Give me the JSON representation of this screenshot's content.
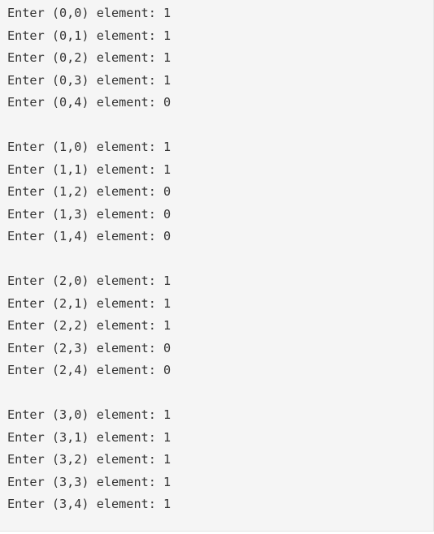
{
  "console": {
    "lines": [
      "Enter (0,0) element: 1",
      "Enter (0,1) element: 1",
      "Enter (0,2) element: 1",
      "Enter (0,3) element: 1",
      "Enter (0,4) element: 0",
      "",
      "Enter (1,0) element: 1",
      "Enter (1,1) element: 1",
      "Enter (1,2) element: 0",
      "Enter (1,3) element: 0",
      "Enter (1,4) element: 0",
      "",
      "Enter (2,0) element: 1",
      "Enter (2,1) element: 1",
      "Enter (2,2) element: 1",
      "Enter (2,3) element: 0",
      "Enter (2,4) element: 0",
      "",
      "Enter (3,0) element: 1",
      "Enter (3,1) element: 1",
      "Enter (3,2) element: 1",
      "Enter (3,3) element: 1",
      "Enter (3,4) element: 1"
    ]
  }
}
